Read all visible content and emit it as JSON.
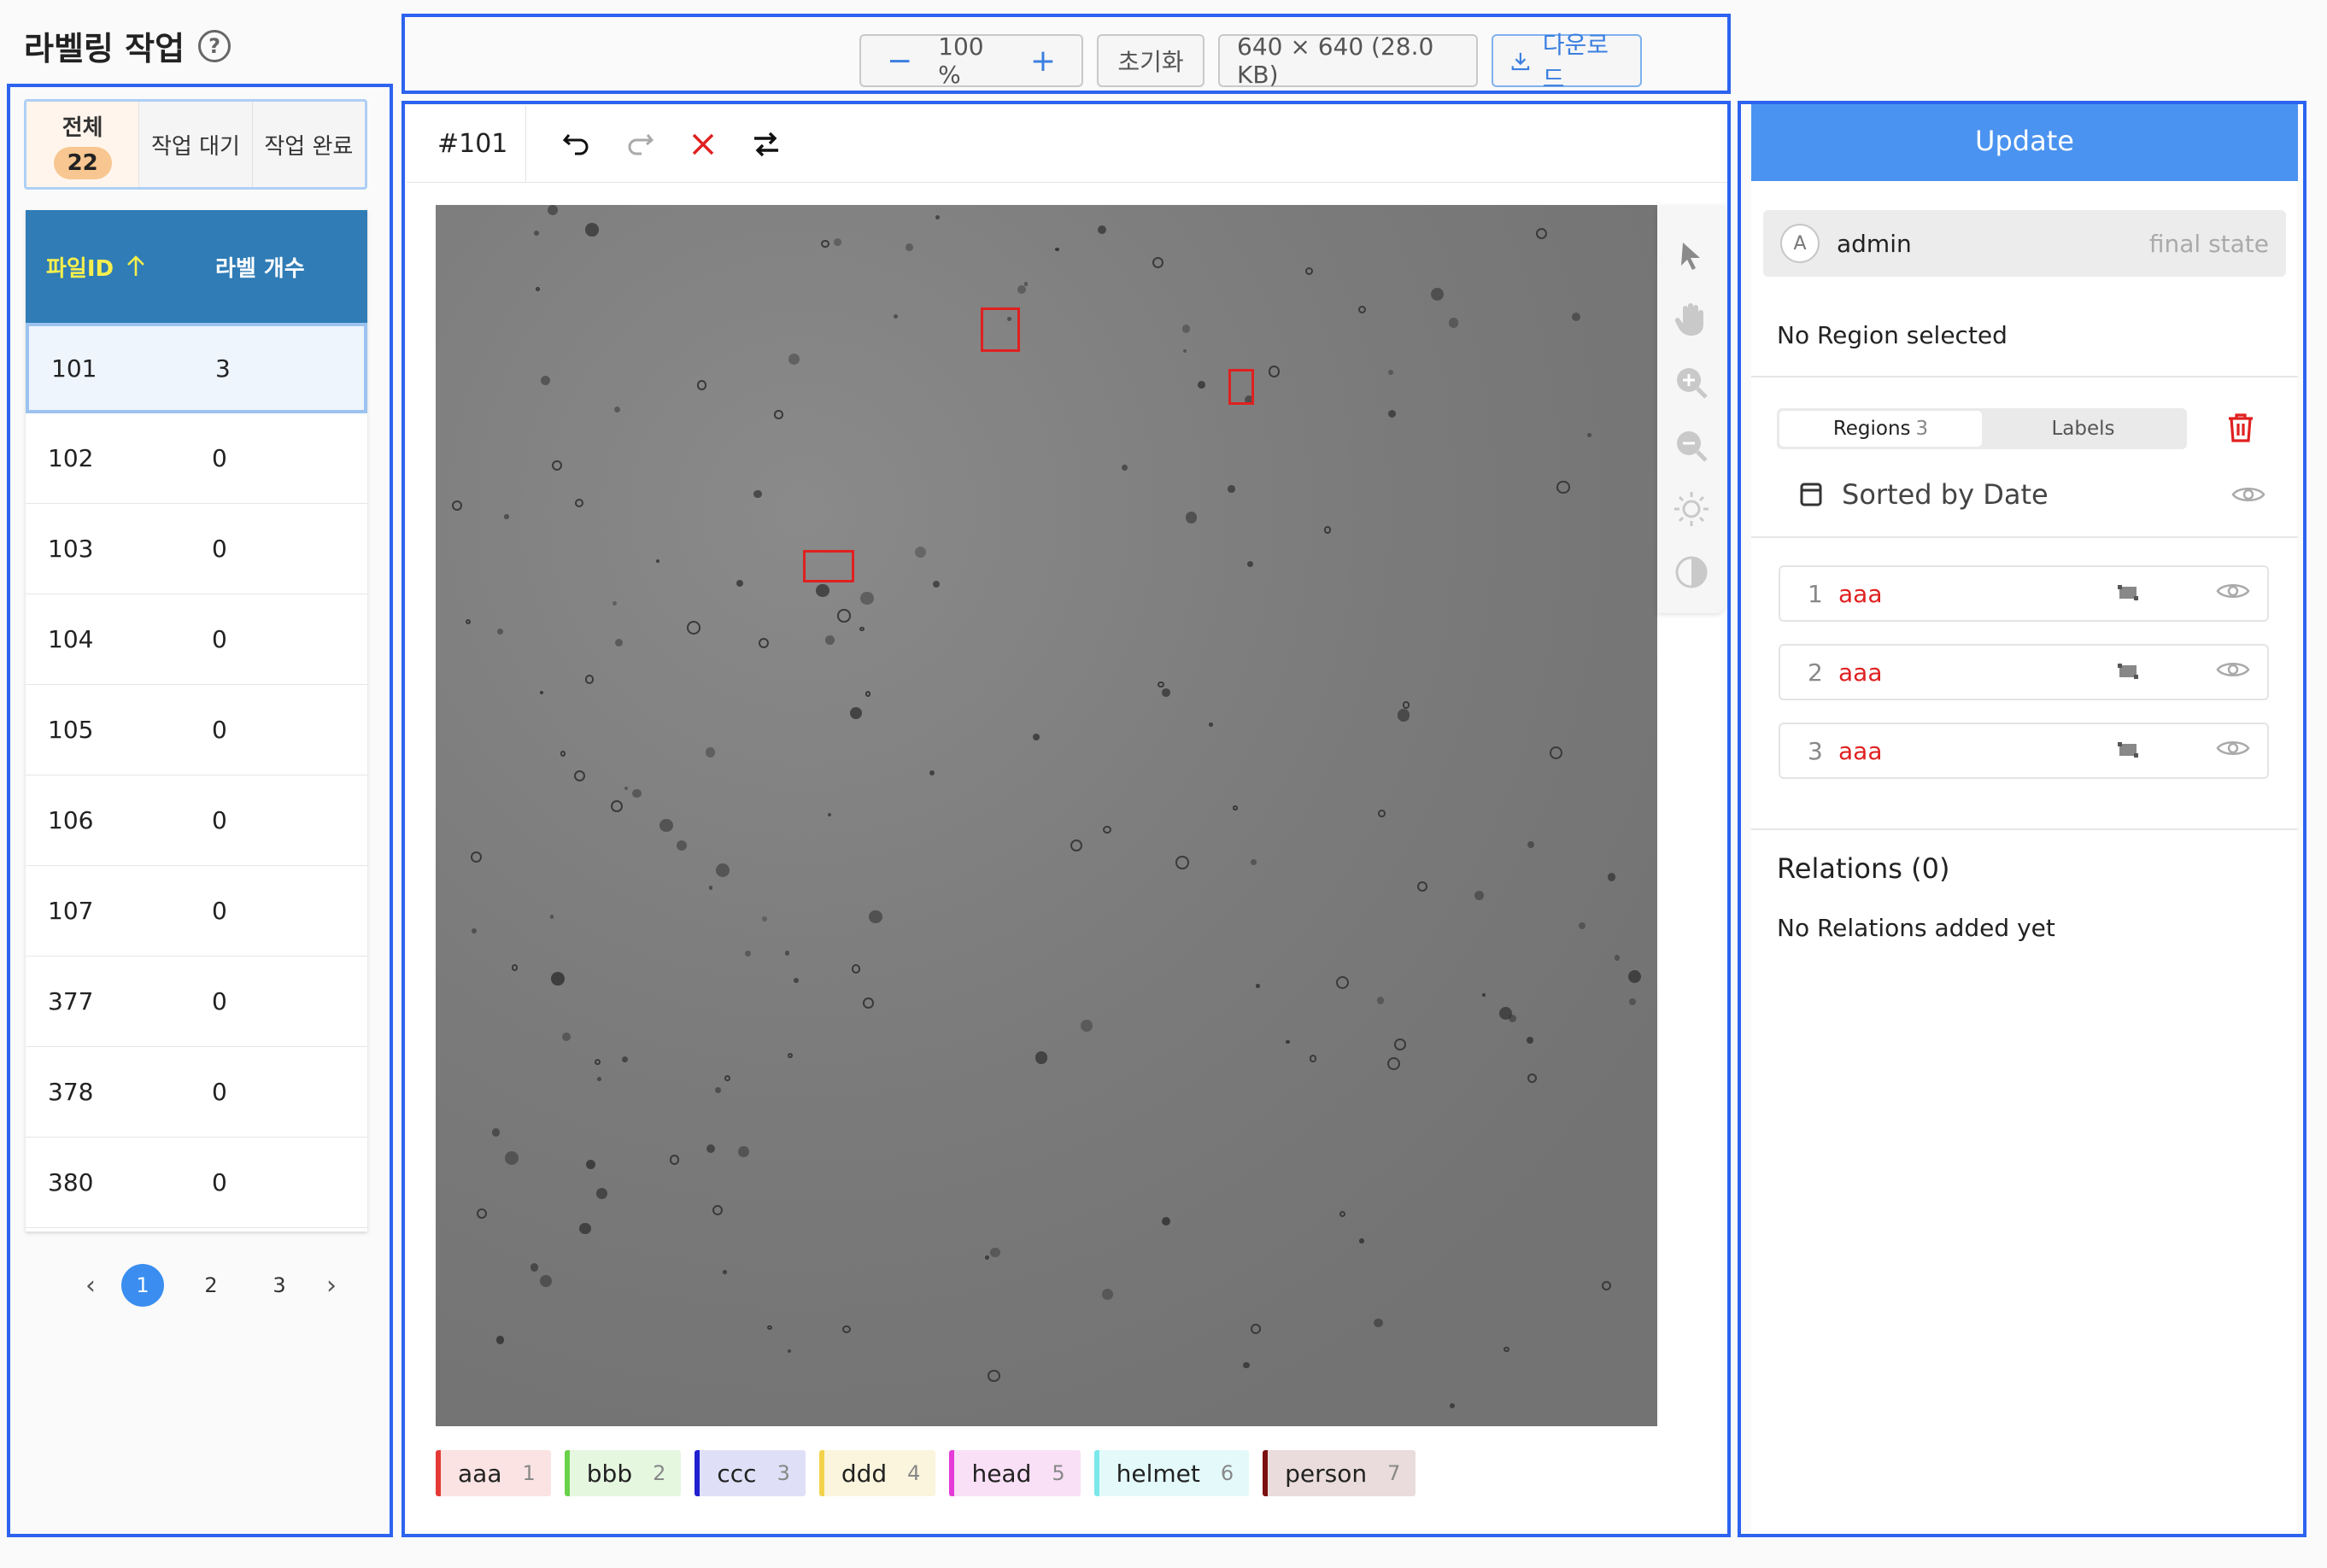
{
  "sidebar": {
    "title": "라벨링 작업",
    "tabs": [
      {
        "label": "전체",
        "count": "22"
      },
      {
        "label": "작업 대기"
      },
      {
        "label": "작업 완료"
      }
    ],
    "table": {
      "headers": [
        "파일ID",
        "라벨 개수"
      ],
      "rows": [
        {
          "id": "101",
          "count": "3"
        },
        {
          "id": "102",
          "count": "0"
        },
        {
          "id": "103",
          "count": "0"
        },
        {
          "id": "104",
          "count": "0"
        },
        {
          "id": "105",
          "count": "0"
        },
        {
          "id": "106",
          "count": "0"
        },
        {
          "id": "107",
          "count": "0"
        },
        {
          "id": "377",
          "count": "0"
        },
        {
          "id": "378",
          "count": "0"
        },
        {
          "id": "380",
          "count": "0"
        }
      ]
    },
    "pagination": {
      "pages": [
        "1",
        "2",
        "3"
      ],
      "current": "1",
      "prev": "‹",
      "next": "›"
    }
  },
  "toolbar": {
    "zoom_minus": "−",
    "zoom": "100 %",
    "zoom_plus": "+",
    "reset": "초기화",
    "image_info": "640 × 640 (28.0 KB)",
    "download": "다운로드"
  },
  "workspace": {
    "file_no": "#101",
    "labels": [
      {
        "name": "aaa",
        "num": "1",
        "color": "#e53935",
        "bg": "#fbe3e3"
      },
      {
        "name": "bbb",
        "num": "2",
        "color": "#6ad24a",
        "bg": "#e6f7e0"
      },
      {
        "name": "ccc",
        "num": "3",
        "color": "#2020d0",
        "bg": "#dfe0f7"
      },
      {
        "name": "ddd",
        "num": "4",
        "color": "#f2d24a",
        "bg": "#fbf5dd"
      },
      {
        "name": "head",
        "num": "5",
        "color": "#e53ad8",
        "bg": "#f9e0f6"
      },
      {
        "name": "helmet",
        "num": "6",
        "color": "#7ae8ea",
        "bg": "#e4fafa"
      },
      {
        "name": "person",
        "num": "7",
        "color": "#7a1010",
        "bg": "#eadcdc"
      }
    ]
  },
  "right_panel": {
    "update": "Update",
    "user": {
      "avatar": "A",
      "name": "admin",
      "state": "final state"
    },
    "no_region": "No Region selected",
    "seg": {
      "regions": "Regions",
      "regions_count": "3",
      "labels": "Labels"
    },
    "sorted": "Sorted by Date",
    "regions": [
      {
        "idx": "1",
        "name": "aaa"
      },
      {
        "idx": "2",
        "name": "aaa"
      },
      {
        "idx": "3",
        "name": "aaa"
      }
    ],
    "relations_title": "Relations (0)",
    "relations_text": "No Relations added yet"
  }
}
